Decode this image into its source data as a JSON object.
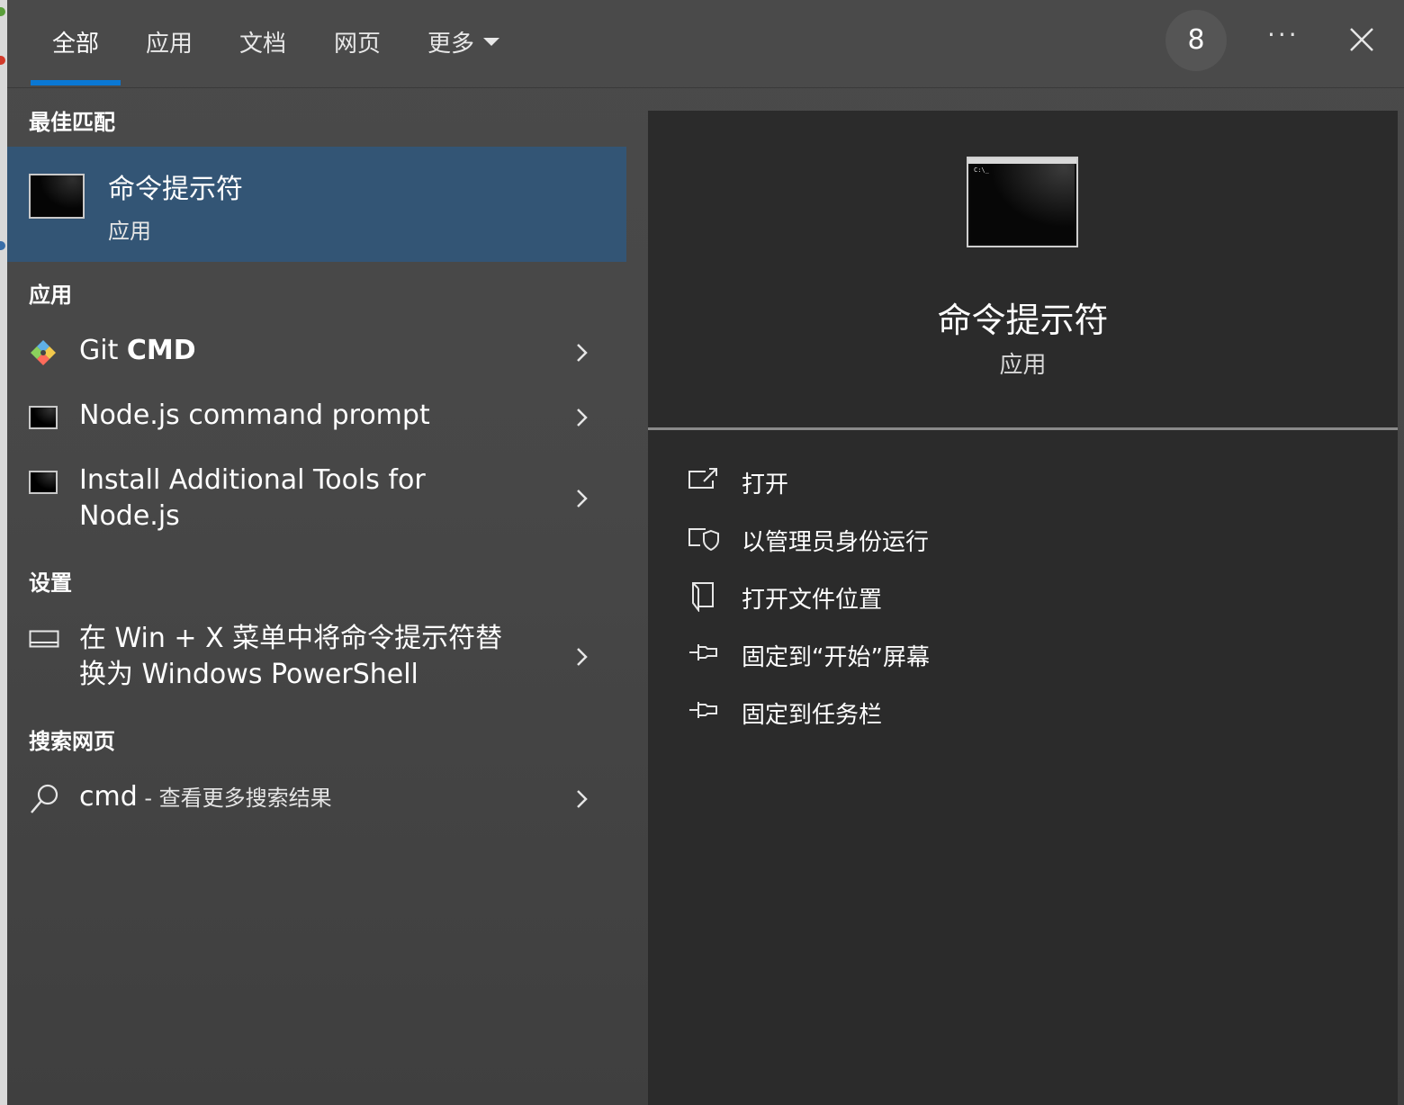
{
  "tabs": {
    "all": "全部",
    "apps": "应用",
    "docs": "文档",
    "web": "网页",
    "more": "更多"
  },
  "header": {
    "badge_count": "8",
    "more_label": "···"
  },
  "sections": {
    "best_match": "最佳匹配",
    "apps": "应用",
    "settings": "设置",
    "search_web": "搜索网页"
  },
  "best_match": {
    "title": "命令提示符",
    "subtitle": "应用"
  },
  "apps": [
    {
      "label_plain": "Git ",
      "label_bold": "CMD",
      "icon": "git-icon"
    },
    {
      "label": "Node.js command prompt",
      "icon": "console-icon"
    },
    {
      "label_line1": "Install Additional Tools for",
      "label_line2": "Node.js",
      "icon": "console-icon"
    }
  ],
  "settings": [
    {
      "label_line1": "在 Win + X 菜单中将命令提示符替",
      "label_line2": "换为 Windows PowerShell",
      "icon": "display-icon"
    }
  ],
  "web": {
    "query": "cmd",
    "suffix": " - 查看更多搜索结果",
    "icon": "search-icon"
  },
  "preview": {
    "title": "命令提示符",
    "subtitle": "应用",
    "prompt_text": "C:\\_",
    "actions": [
      {
        "label": "打开",
        "icon": "open-icon"
      },
      {
        "label": "以管理员身份运行",
        "icon": "run-as-admin-icon"
      },
      {
        "label": "打开文件位置",
        "icon": "file-location-icon"
      },
      {
        "label": "固定到“开始”屏幕",
        "icon": "pin-start-icon"
      },
      {
        "label": "固定到任务栏",
        "icon": "pin-taskbar-icon"
      }
    ]
  },
  "colors": {
    "accent": "#0a78d4",
    "selection": "#335575",
    "panel_dark": "#2b2b2b"
  }
}
